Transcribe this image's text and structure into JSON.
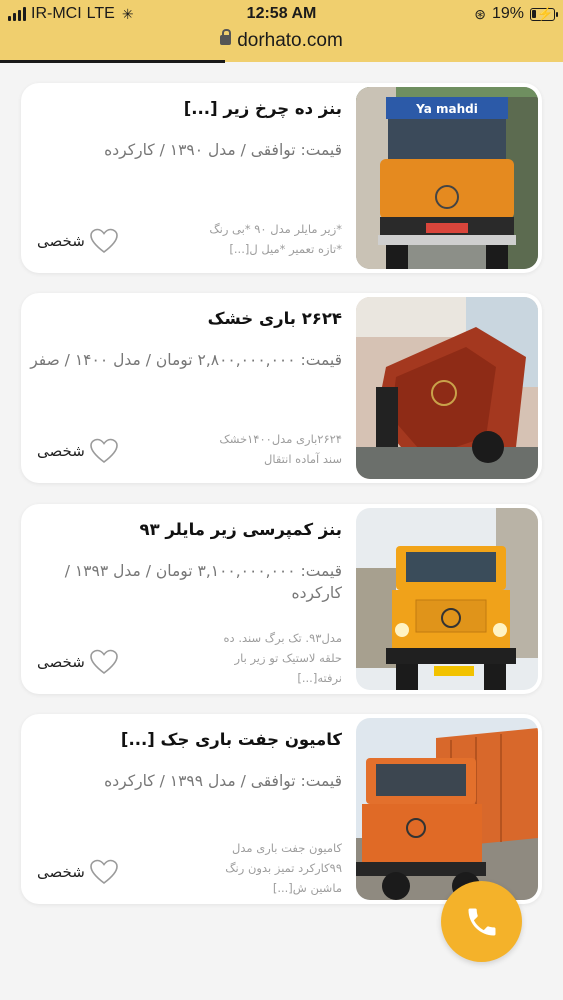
{
  "status_bar": {
    "carrier": "IR-MCI",
    "network": "LTE",
    "time": "12:58 AM",
    "battery": "19%",
    "battery_level": 0.19
  },
  "browser": {
    "url": "dorhato.com",
    "load_progress": 0.4
  },
  "colors": {
    "accent": "#f0cf6e",
    "call_button": "#f4b22a"
  },
  "listings": [
    {
      "title": "بنز ده چرخ زیر [...]",
      "price": "قیمت: توافقی / مدل ۱۳۹۰ / کارکرده",
      "description": [
        "*زیر مایلر مدل ۹۰ *بی رنگ",
        "*تازه تعمیر *میل ل[...]"
      ],
      "seller": "شخصی",
      "favorite_icon": "heart-outline-icon"
    },
    {
      "title": "۲۶۲۴ باری خشک",
      "price": "قیمت: ۲,۸۰۰,۰۰۰,۰۰۰ تومان / مدل ۱۴۰۰ / صفر",
      "description": [
        "۲۶۲۴باری مدل۱۴۰۰خشک",
        "سند آماده انتقال"
      ],
      "seller": "شخصی",
      "favorite_icon": "heart-outline-icon"
    },
    {
      "title": "بنز کمپرسی زیر مایلر ۹۳",
      "price": "قیمت: ۳,۱۰۰,۰۰۰,۰۰۰ تومان / مدل ۱۳۹۳ / کارکرده",
      "description": [
        "مدل۹۳. تک برگ سند. ده",
        "حلقه لاستیک تو زیر بار",
        "نرفته[...]"
      ],
      "seller": "شخصی",
      "favorite_icon": "heart-outline-icon"
    },
    {
      "title": "کامیون جفت باری جک [...]",
      "price": "قیمت: توافقی / مدل ۱۳۹۹ / کارکرده",
      "description": [
        "کامیون جفت باری مدل",
        "۹۹کارکرد تمیز بدون رنگ",
        "ماشین ش[...]"
      ],
      "seller": "شخصی",
      "favorite_icon": "heart-outline-icon"
    }
  ],
  "call_button_icon": "phone-icon"
}
